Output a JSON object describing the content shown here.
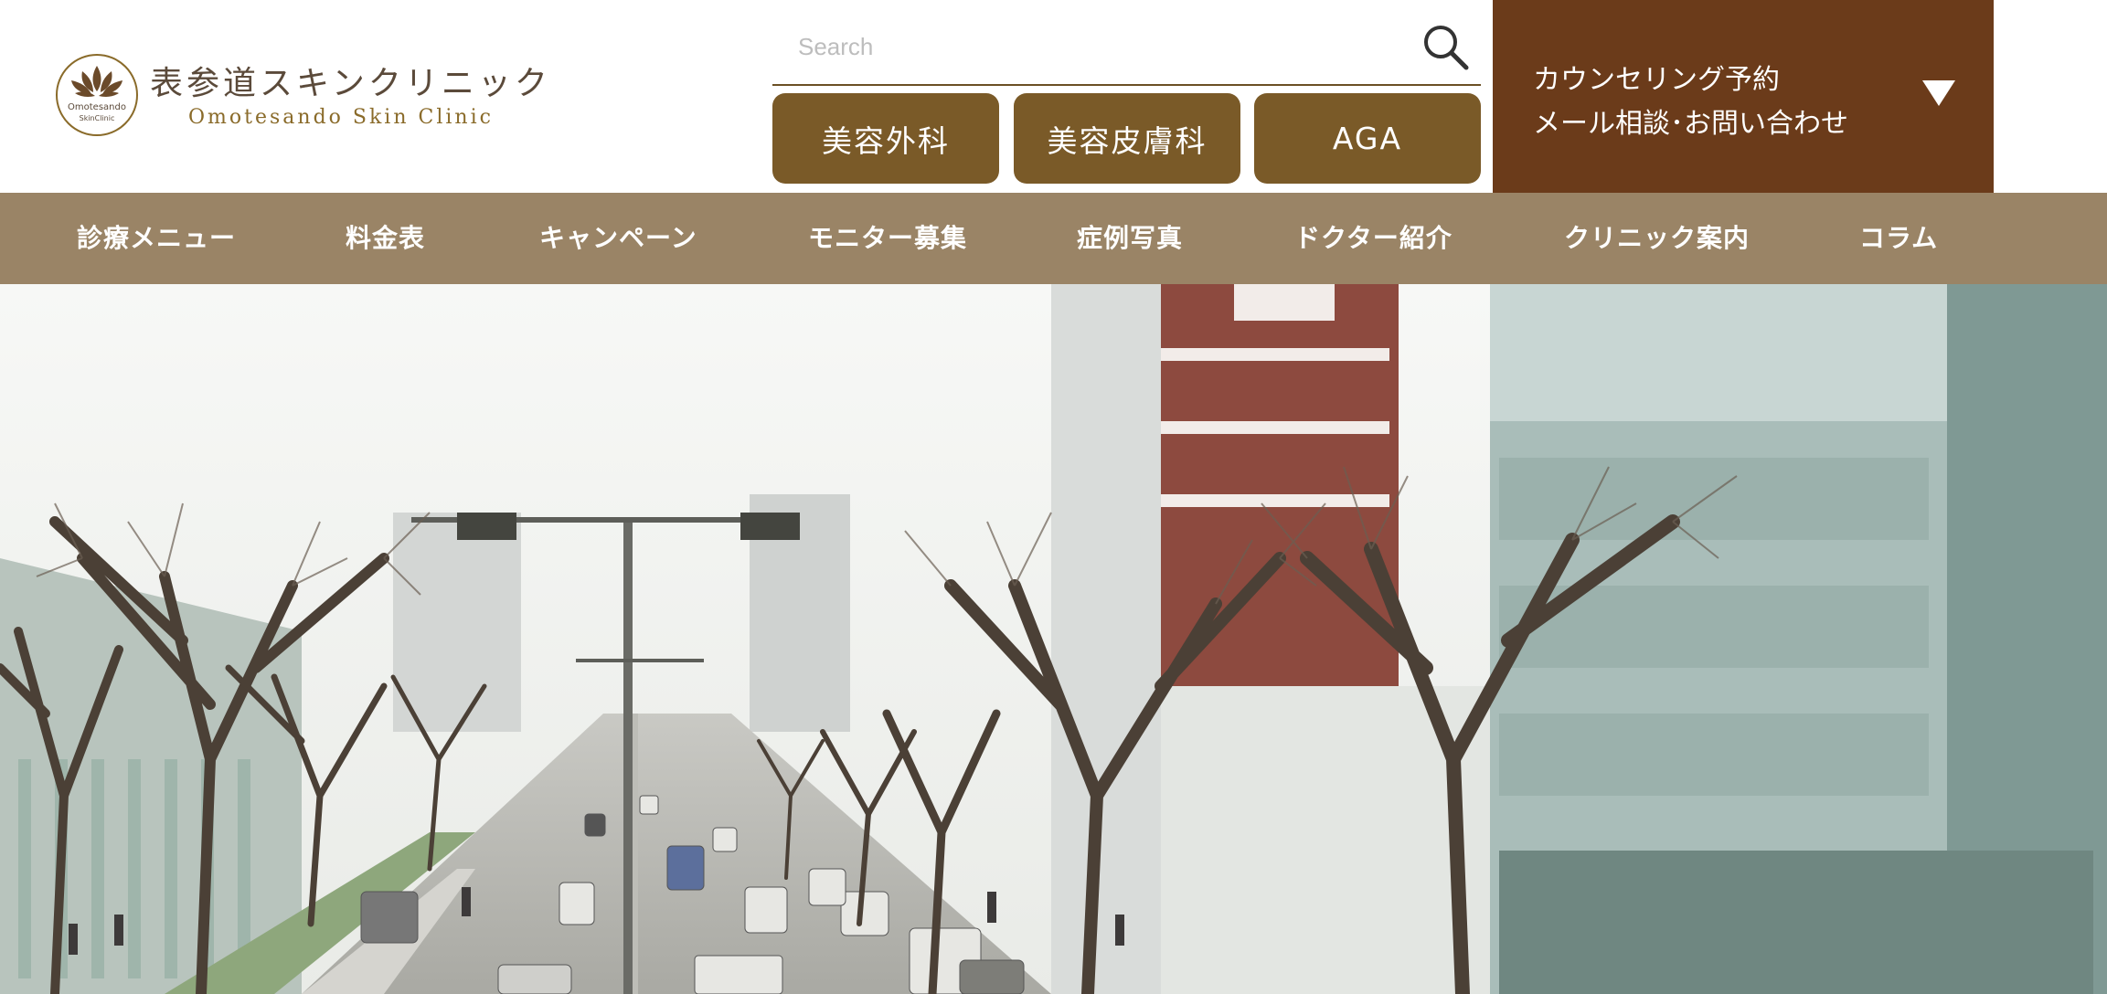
{
  "header": {
    "logo": {
      "name_jp": "表参道スキンクリニック",
      "name_en": "Omotesando Skin Clinic",
      "mark_text_1": "Omotesando",
      "mark_text_2": "SkinClinic"
    },
    "search": {
      "placeholder": "Search",
      "value": ""
    },
    "tabs": [
      {
        "label": "美容外科"
      },
      {
        "label": "美容皮膚科"
      },
      {
        "label": "AGA"
      }
    ],
    "cta": {
      "line1": "カウンセリング予約",
      "line2": "メール相談･お問い合わせ"
    }
  },
  "nav": {
    "items": [
      {
        "label": "診療メニュー"
      },
      {
        "label": "料金表"
      },
      {
        "label": "キャンペーン"
      },
      {
        "label": "モニター募集"
      },
      {
        "label": "症例写真"
      },
      {
        "label": "ドクター紹介"
      },
      {
        "label": "クリニック案内"
      },
      {
        "label": "コラム"
      }
    ]
  },
  "colors": {
    "brown_button": "#7a5a28",
    "cta_bg": "#6b3b1a",
    "nav_bg": "#9a8466",
    "logo_gold": "#8a6b2a"
  },
  "icons": {
    "search": "search-icon",
    "dropdown": "triangle-down-icon",
    "logo": "lotus-logo-icon"
  }
}
